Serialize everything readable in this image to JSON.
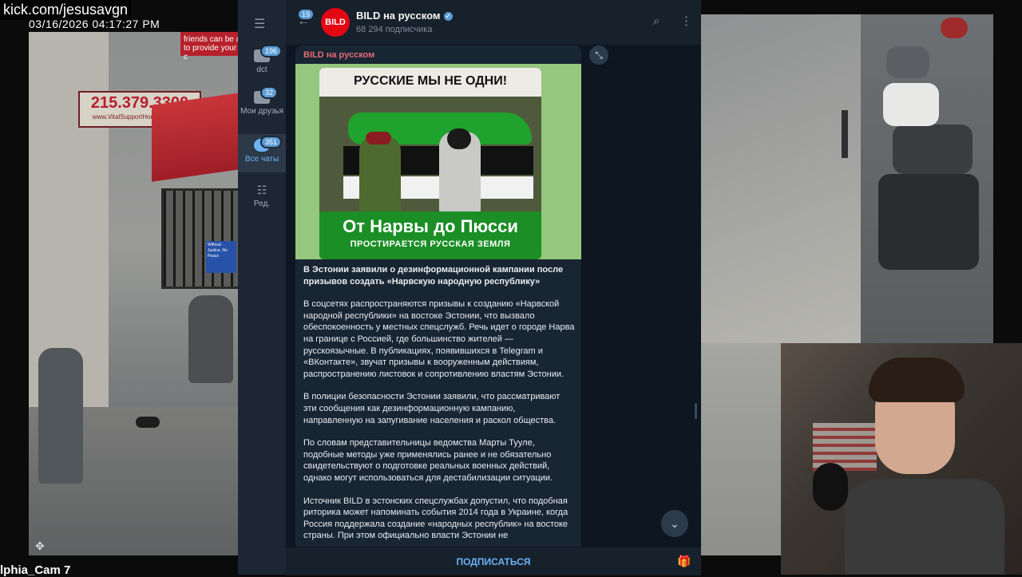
{
  "stream": {
    "kick_url": "kick.com/jesusavgn",
    "cam_timestamp": "03/16/2026 04:17:27 PM",
    "cam_label": "lphia_Cam 7",
    "phone_sign": "215.379.3300",
    "phone_sign_sub": "www.VitalSupportHomeCare.com",
    "top_banner_text_1": "friends can be a",
    "top_banner_text_2": "to provide your c",
    "blue_sign_text": "Without Justice, No Peace"
  },
  "telegram": {
    "rail": {
      "folders": [
        {
          "label": "dct",
          "badge": "196"
        },
        {
          "label": "Мои друзья",
          "badge": "32"
        },
        {
          "label": "Все чаты",
          "badge": "351",
          "active": true
        },
        {
          "label": "Ред.",
          "badge": ""
        }
      ]
    },
    "header": {
      "back_badge": "19",
      "avatar_text": "BILD",
      "channel_name": "BILD на русском",
      "subscribers": "68 294 подписчика"
    },
    "message": {
      "author": "BILD на русском",
      "poster": {
        "top": "РУССКИЕ МЫ НЕ ОДНИ!",
        "bottom_line1": "От Нарвы до Пюсси",
        "bottom_line2": "ПРОСТИРАЕТСЯ РУССКАЯ ЗЕМЛЯ"
      },
      "title": "В Эстонии заявили о дезинформационной кампании после призывов создать «Нарвскую народную республику»",
      "paragraphs": [
        "В соцсетях распространяются призывы к созданию «Нарвской народной республики» на востоке Эстонии, что вызвало обеспокоенность у местных спецслужб. Речь идет о городе Нарва на границе с Россией, где большинство жителей — русскоязычные. В публикациях, появившихся в Telegram и «ВКонтакте», звучат призывы к вооруженным действиям, распространению листовок и сопротивлению властям Эстонии.",
        "В полиции безопасности Эстонии заявили, что рассматривают эти сообщения как дезинформационную кампанию, направленную на запугивание населения и раскол общества.",
        "По словам представительницы ведомства Марты Тууле, подобные методы уже применялись ранее и не обязательно свидетельствуют о подготовке реальных военных действий, однако могут использоваться для дестабилизации ситуации.",
        "Источник BILD в эстонских спецслужбах допустил, что подобная риторика может напоминать события 2014 года в Украине, когда Россия поддержала создание «народных республик» на востоке страны. При этом официально власти Эстонии не"
      ]
    },
    "footer": {
      "subscribe_label": "ПОДПИСАТЬСЯ"
    }
  },
  "colors": {
    "accent": "#6cb2f7",
    "author": "#e06c75",
    "chat_bg": "#0e1621",
    "bubble": "#182533"
  },
  "icons": [
    "menu-icon",
    "folder-icon",
    "chat-bubbles-icon",
    "sliders-icon",
    "back-arrow-icon",
    "verified-icon",
    "search-icon",
    "more-vertical-icon",
    "collapse-icon",
    "chevron-down-icon",
    "gift-icon",
    "crosshair-icon"
  ]
}
